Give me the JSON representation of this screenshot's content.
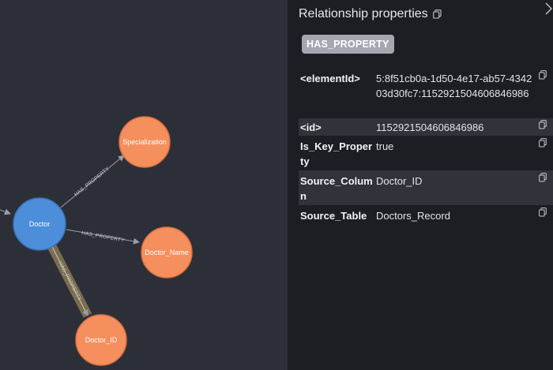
{
  "graph": {
    "nodes": [
      {
        "id": "doctor",
        "label": "Doctor",
        "color": "#4c8ed9",
        "stroke": "#3a72b6"
      },
      {
        "id": "specialization",
        "label": "Specialization",
        "color": "#f58f5d",
        "stroke": "#d8703f"
      },
      {
        "id": "doctor_name",
        "label": "Doctor_Name",
        "color": "#f58f5d",
        "stroke": "#d8703f"
      },
      {
        "id": "doctor_id",
        "label": "Doctor_ID",
        "color": "#f58f5d",
        "stroke": "#d8703f"
      }
    ],
    "edges": [
      {
        "from": "doctor",
        "to": "specialization",
        "label": "HAS_PROPERTY",
        "selected": false
      },
      {
        "from": "doctor",
        "to": "doctor_name",
        "label": "HAS_PROPERTY",
        "selected": false
      },
      {
        "from": "doctor",
        "to": "doctor_id",
        "label": "HAS_PROPERTY",
        "selected": true
      }
    ],
    "colors": {
      "edge": "#9a9ea8",
      "selected_halo": "#7a6d4d",
      "canvas": "#2d2f38"
    }
  },
  "inspector": {
    "title": "Relationship properties",
    "type_badge": "HAS_PROPERTY",
    "properties": [
      {
        "key": "<elementId>",
        "value": "5:8f51cb0a-1d50-4e17-ab57-434203d30fc7:1152921504606846986"
      },
      {
        "key": "<id>",
        "value": "1152921504606846986"
      },
      {
        "key": "Is_Key_Property",
        "value": "true"
      },
      {
        "key": "Source_Column",
        "value": "Doctor_ID"
      },
      {
        "key": "Source_Table",
        "value": "Doctors_Record"
      }
    ]
  }
}
